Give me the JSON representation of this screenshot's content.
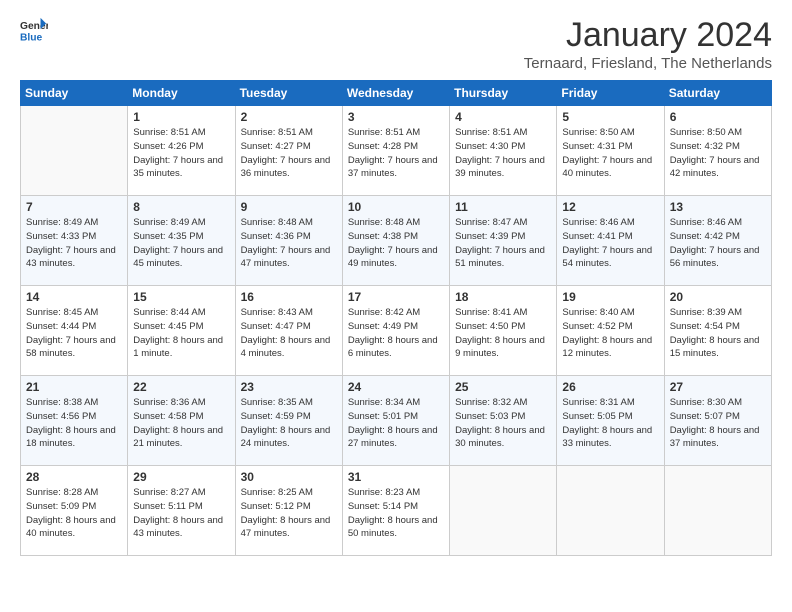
{
  "logo": {
    "line1": "General",
    "line2": "Blue"
  },
  "title": "January 2024",
  "subtitle": "Ternaard, Friesland, The Netherlands",
  "days_header": [
    "Sunday",
    "Monday",
    "Tuesday",
    "Wednesday",
    "Thursday",
    "Friday",
    "Saturday"
  ],
  "weeks": [
    [
      {
        "num": "",
        "sunrise": "",
        "sunset": "",
        "daylight": ""
      },
      {
        "num": "1",
        "sunrise": "Sunrise: 8:51 AM",
        "sunset": "Sunset: 4:26 PM",
        "daylight": "Daylight: 7 hours and 35 minutes."
      },
      {
        "num": "2",
        "sunrise": "Sunrise: 8:51 AM",
        "sunset": "Sunset: 4:27 PM",
        "daylight": "Daylight: 7 hours and 36 minutes."
      },
      {
        "num": "3",
        "sunrise": "Sunrise: 8:51 AM",
        "sunset": "Sunset: 4:28 PM",
        "daylight": "Daylight: 7 hours and 37 minutes."
      },
      {
        "num": "4",
        "sunrise": "Sunrise: 8:51 AM",
        "sunset": "Sunset: 4:30 PM",
        "daylight": "Daylight: 7 hours and 39 minutes."
      },
      {
        "num": "5",
        "sunrise": "Sunrise: 8:50 AM",
        "sunset": "Sunset: 4:31 PM",
        "daylight": "Daylight: 7 hours and 40 minutes."
      },
      {
        "num": "6",
        "sunrise": "Sunrise: 8:50 AM",
        "sunset": "Sunset: 4:32 PM",
        "daylight": "Daylight: 7 hours and 42 minutes."
      }
    ],
    [
      {
        "num": "7",
        "sunrise": "Sunrise: 8:49 AM",
        "sunset": "Sunset: 4:33 PM",
        "daylight": "Daylight: 7 hours and 43 minutes."
      },
      {
        "num": "8",
        "sunrise": "Sunrise: 8:49 AM",
        "sunset": "Sunset: 4:35 PM",
        "daylight": "Daylight: 7 hours and 45 minutes."
      },
      {
        "num": "9",
        "sunrise": "Sunrise: 8:48 AM",
        "sunset": "Sunset: 4:36 PM",
        "daylight": "Daylight: 7 hours and 47 minutes."
      },
      {
        "num": "10",
        "sunrise": "Sunrise: 8:48 AM",
        "sunset": "Sunset: 4:38 PM",
        "daylight": "Daylight: 7 hours and 49 minutes."
      },
      {
        "num": "11",
        "sunrise": "Sunrise: 8:47 AM",
        "sunset": "Sunset: 4:39 PM",
        "daylight": "Daylight: 7 hours and 51 minutes."
      },
      {
        "num": "12",
        "sunrise": "Sunrise: 8:46 AM",
        "sunset": "Sunset: 4:41 PM",
        "daylight": "Daylight: 7 hours and 54 minutes."
      },
      {
        "num": "13",
        "sunrise": "Sunrise: 8:46 AM",
        "sunset": "Sunset: 4:42 PM",
        "daylight": "Daylight: 7 hours and 56 minutes."
      }
    ],
    [
      {
        "num": "14",
        "sunrise": "Sunrise: 8:45 AM",
        "sunset": "Sunset: 4:44 PM",
        "daylight": "Daylight: 7 hours and 58 minutes."
      },
      {
        "num": "15",
        "sunrise": "Sunrise: 8:44 AM",
        "sunset": "Sunset: 4:45 PM",
        "daylight": "Daylight: 8 hours and 1 minute."
      },
      {
        "num": "16",
        "sunrise": "Sunrise: 8:43 AM",
        "sunset": "Sunset: 4:47 PM",
        "daylight": "Daylight: 8 hours and 4 minutes."
      },
      {
        "num": "17",
        "sunrise": "Sunrise: 8:42 AM",
        "sunset": "Sunset: 4:49 PM",
        "daylight": "Daylight: 8 hours and 6 minutes."
      },
      {
        "num": "18",
        "sunrise": "Sunrise: 8:41 AM",
        "sunset": "Sunset: 4:50 PM",
        "daylight": "Daylight: 8 hours and 9 minutes."
      },
      {
        "num": "19",
        "sunrise": "Sunrise: 8:40 AM",
        "sunset": "Sunset: 4:52 PM",
        "daylight": "Daylight: 8 hours and 12 minutes."
      },
      {
        "num": "20",
        "sunrise": "Sunrise: 8:39 AM",
        "sunset": "Sunset: 4:54 PM",
        "daylight": "Daylight: 8 hours and 15 minutes."
      }
    ],
    [
      {
        "num": "21",
        "sunrise": "Sunrise: 8:38 AM",
        "sunset": "Sunset: 4:56 PM",
        "daylight": "Daylight: 8 hours and 18 minutes."
      },
      {
        "num": "22",
        "sunrise": "Sunrise: 8:36 AM",
        "sunset": "Sunset: 4:58 PM",
        "daylight": "Daylight: 8 hours and 21 minutes."
      },
      {
        "num": "23",
        "sunrise": "Sunrise: 8:35 AM",
        "sunset": "Sunset: 4:59 PM",
        "daylight": "Daylight: 8 hours and 24 minutes."
      },
      {
        "num": "24",
        "sunrise": "Sunrise: 8:34 AM",
        "sunset": "Sunset: 5:01 PM",
        "daylight": "Daylight: 8 hours and 27 minutes."
      },
      {
        "num": "25",
        "sunrise": "Sunrise: 8:32 AM",
        "sunset": "Sunset: 5:03 PM",
        "daylight": "Daylight: 8 hours and 30 minutes."
      },
      {
        "num": "26",
        "sunrise": "Sunrise: 8:31 AM",
        "sunset": "Sunset: 5:05 PM",
        "daylight": "Daylight: 8 hours and 33 minutes."
      },
      {
        "num": "27",
        "sunrise": "Sunrise: 8:30 AM",
        "sunset": "Sunset: 5:07 PM",
        "daylight": "Daylight: 8 hours and 37 minutes."
      }
    ],
    [
      {
        "num": "28",
        "sunrise": "Sunrise: 8:28 AM",
        "sunset": "Sunset: 5:09 PM",
        "daylight": "Daylight: 8 hours and 40 minutes."
      },
      {
        "num": "29",
        "sunrise": "Sunrise: 8:27 AM",
        "sunset": "Sunset: 5:11 PM",
        "daylight": "Daylight: 8 hours and 43 minutes."
      },
      {
        "num": "30",
        "sunrise": "Sunrise: 8:25 AM",
        "sunset": "Sunset: 5:12 PM",
        "daylight": "Daylight: 8 hours and 47 minutes."
      },
      {
        "num": "31",
        "sunrise": "Sunrise: 8:23 AM",
        "sunset": "Sunset: 5:14 PM",
        "daylight": "Daylight: 8 hours and 50 minutes."
      },
      {
        "num": "",
        "sunrise": "",
        "sunset": "",
        "daylight": ""
      },
      {
        "num": "",
        "sunrise": "",
        "sunset": "",
        "daylight": ""
      },
      {
        "num": "",
        "sunrise": "",
        "sunset": "",
        "daylight": ""
      }
    ]
  ]
}
